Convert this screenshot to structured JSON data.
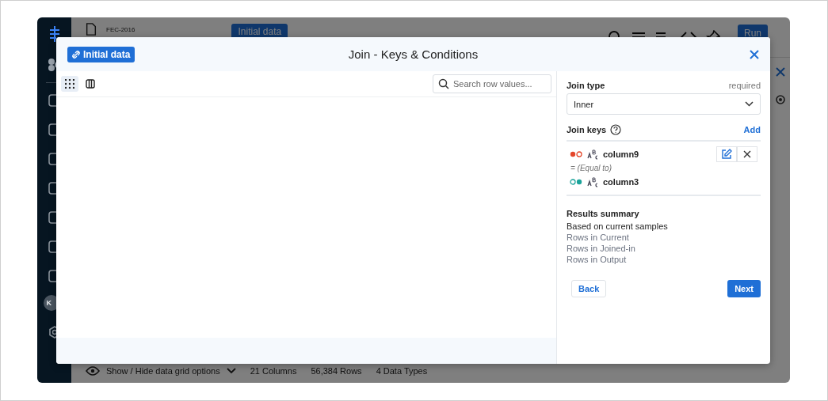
{
  "app": {
    "project": "FEC-2016",
    "badge": "Initial data",
    "run_button": "Run",
    "avatar": "K"
  },
  "status_bar": {
    "toggle": "Show / Hide data grid options",
    "stats": [
      "21 Columns",
      "56,384 Rows",
      "4 Data Types"
    ]
  },
  "dialog": {
    "badge": "Initial data",
    "title": "Join - Keys & Conditions",
    "view_toggles": [
      {
        "kind": "grid",
        "selected": true
      },
      {
        "kind": "columns",
        "selected": false
      }
    ],
    "search": {
      "placeholder": "Search row values..."
    },
    "join_type": {
      "label": "Join type",
      "hint": "required",
      "value": "Inner"
    },
    "join_keys": {
      "label": "Join keys",
      "action": "Add",
      "keys": [
        {
          "kind": "current",
          "column": "column9"
        },
        {
          "kind": "joined",
          "column": "column3"
        }
      ],
      "operator": "= (Equal to)"
    },
    "summary": {
      "title": "Results summary",
      "subtitle": "Based on current samples",
      "rows": [
        "Rows in Current",
        "Rows in Joined-in",
        "Rows in Output"
      ]
    },
    "buttons": {
      "back": "Back",
      "next": "Next"
    }
  }
}
